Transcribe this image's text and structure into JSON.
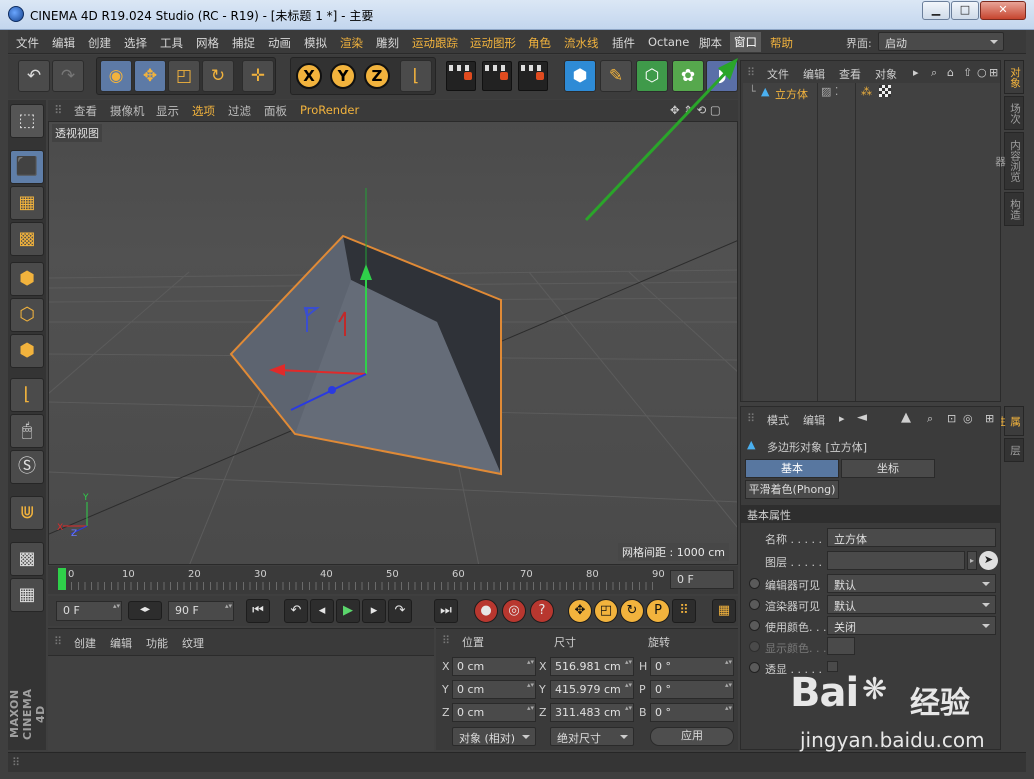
{
  "window": {
    "title": "CINEMA 4D R19.024 Studio (RC - R19) - [未标题 1 *] - 主要",
    "btn_minimize": "▁",
    "btn_maximize": "□",
    "btn_close": "✕"
  },
  "menubar": {
    "items": [
      "文件",
      "编辑",
      "创建",
      "选择",
      "工具",
      "网格",
      "捕捉",
      "动画",
      "模拟",
      "渲染",
      "雕刻",
      "运动跟踪",
      "运动图形",
      "角色",
      "流水线",
      "插件",
      "Octane",
      "脚本",
      "窗口",
      "帮助"
    ],
    "highlighted": "窗口",
    "layout_label": "界面:",
    "layout_value": "启动"
  },
  "viewport": {
    "menu": [
      "查看",
      "摄像机",
      "显示",
      "选项",
      "过滤",
      "面板",
      "ProRender"
    ],
    "active_menu": "选项",
    "label": "透视视图",
    "grid_readout": "网格间距 : 1000 cm"
  },
  "timeline": {
    "ticks": [
      "0",
      "10",
      "20",
      "30",
      "40",
      "50",
      "60",
      "70",
      "80",
      "90"
    ],
    "current_frame": "0 F"
  },
  "transport": {
    "start_field": "0 F",
    "end_field": "90 F"
  },
  "material_manager": {
    "menu": [
      "创建",
      "编辑",
      "功能",
      "纹理"
    ]
  },
  "coordinates": {
    "headers": {
      "position": "位置",
      "size": "尺寸",
      "rotation": "旋转"
    },
    "rows": [
      {
        "axis": "X",
        "pos": "0 cm",
        "size_axis": "X",
        "size": "516.981 cm",
        "rot_axis": "H",
        "rot": "0 °"
      },
      {
        "axis": "Y",
        "pos": "0 cm",
        "size_axis": "Y",
        "size": "415.979 cm",
        "rot_axis": "P",
        "rot": "0 °"
      },
      {
        "axis": "Z",
        "pos": "0 cm",
        "size_axis": "Z",
        "size": "311.483 cm",
        "rot_axis": "B",
        "rot": "0 °"
      }
    ],
    "mode_dropdown": "对象 (相对)",
    "size_dropdown": "绝对尺寸",
    "apply_button": "应用"
  },
  "object_manager": {
    "menu": [
      "文件",
      "编辑",
      "查看",
      "对象"
    ],
    "objects": [
      {
        "name": "立方体"
      }
    ]
  },
  "right_tabs": {
    "top": [
      "对象",
      "场次",
      "内容浏览器",
      "构造"
    ],
    "bottom": [
      "属性",
      "层"
    ]
  },
  "attribute_manager": {
    "menu": [
      "模式",
      "编辑"
    ],
    "object_title": "多边形对象 [立方体]",
    "tabs": [
      "基本",
      "坐标"
    ],
    "active_tab": "基本",
    "subtab": "平滑着色(Phong)",
    "section": "基本属性",
    "props": [
      {
        "label": "名称 . . . . .",
        "value": "立方体",
        "type": "text"
      },
      {
        "label": "图层 . . . . .",
        "value": "",
        "type": "layer"
      },
      {
        "label": "编辑器可见",
        "value": "默认",
        "type": "dropdown"
      },
      {
        "label": "渲染器可见",
        "value": "默认",
        "type": "dropdown"
      },
      {
        "label": "使用颜色. . . .",
        "value": "关闭",
        "type": "dropdown"
      },
      {
        "label": "显示颜色. . .",
        "value": "",
        "type": "color"
      },
      {
        "label": "透显 . . . . .",
        "value": "",
        "type": "checkbox"
      }
    ]
  },
  "watermark": {
    "brand": "Bai",
    "brand_suffix": "经验",
    "url": "jingyan.baidu.com"
  },
  "colors": {
    "accent": "#f2b33d",
    "selection": "#5877a0",
    "annotation_arrow": "#2aa52a"
  }
}
